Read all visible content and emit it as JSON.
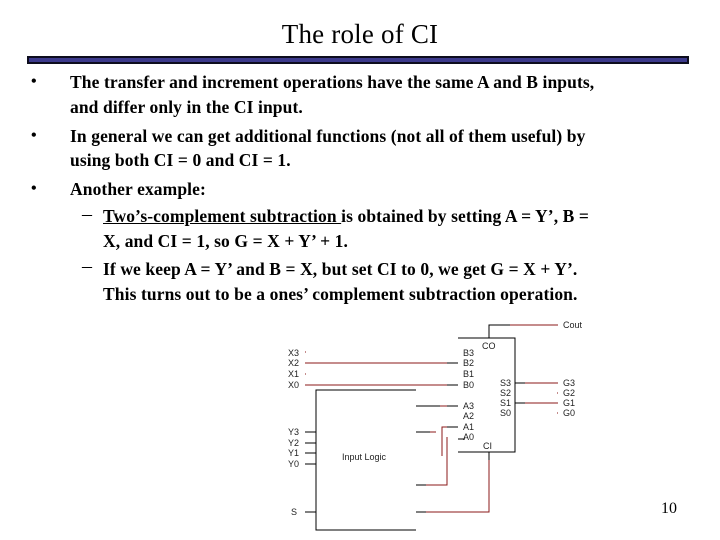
{
  "slide": {
    "title": "The role of CI",
    "page_number": "10",
    "bullets": [
      {
        "symbol": "•",
        "lines": [
          "The transfer and increment operations have the same A and B inputs,",
          "and differ only in the CI input."
        ]
      },
      {
        "symbol": "•",
        "lines": [
          "In general we can get additional functions (not all of them useful) by",
          "using both CI = 0 and CI = 1."
        ]
      },
      {
        "symbol": "•",
        "lines": [
          "Another example:"
        ],
        "subitems": [
          {
            "symbol": "–",
            "underlined": "Two’s-complement subtraction ",
            "rest": "is obtained by setting A = Y’, B =",
            "line2": "X, and CI = 1, so G = X + Y’ + 1."
          },
          {
            "symbol": "–",
            "line1": "If we keep A = Y’ and B = X, but set CI to 0, we get G = X + Y’.",
            "line2": "This turns out to be a ones’ complement subtraction operation."
          }
        ]
      }
    ]
  },
  "diagram": {
    "left_inputs_x": [
      "X3",
      "X2",
      "X1",
      "X0"
    ],
    "left_inputs_y": [
      "Y3",
      "Y2",
      "Y1",
      "Y0"
    ],
    "select_input": "S",
    "logic_block_label": "Input Logic",
    "adder_inputs_b": [
      "B3",
      "B2",
      "B1",
      "B0"
    ],
    "adder_inputs_a": [
      "A3",
      "A2",
      "A1",
      "A0"
    ],
    "adder_outputs_s": [
      "S3",
      "S2",
      "S1",
      "S0"
    ],
    "adder_carry_out": "CO",
    "adder_carry_in": "CI",
    "outputs_g": [
      "G3",
      "G2",
      "G1",
      "G0"
    ],
    "carry_out_label": "Cout",
    "wire_color": "#8b1a1a"
  }
}
